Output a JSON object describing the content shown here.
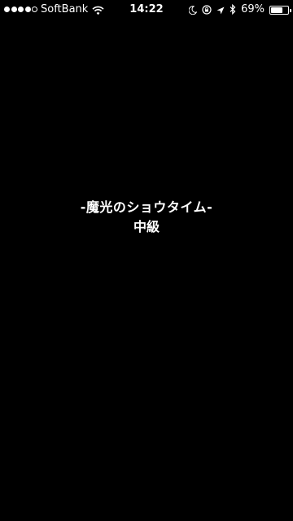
{
  "status_bar": {
    "signal_bars_filled": 4,
    "signal_bars_total": 5,
    "carrier": "SoftBank",
    "time": "14:22",
    "battery_percent": "69%",
    "battery_level": 0.69,
    "icons": [
      "wifi-icon",
      "moon-icon",
      "rotation-lock-icon",
      "location-arrow-icon",
      "bluetooth-icon",
      "battery-icon"
    ]
  },
  "screen": {
    "title": "-魔光のショウタイム-",
    "difficulty": "中級"
  },
  "colors": {
    "background": "#000000",
    "foreground": "#ffffff"
  }
}
